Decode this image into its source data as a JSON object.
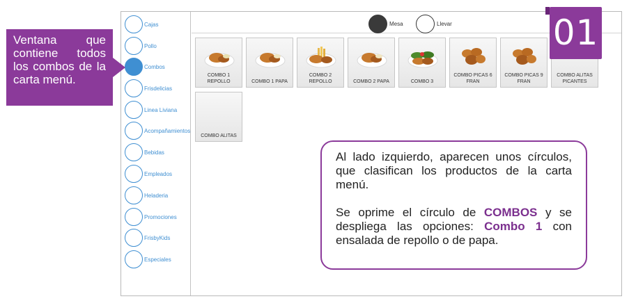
{
  "categories": [
    {
      "label": "Cajas"
    },
    {
      "label": "Pollo"
    },
    {
      "label": "Combos",
      "active": true
    },
    {
      "label": "Frisdelicias"
    },
    {
      "label": "Linea Liviana"
    },
    {
      "label": "Acompañamientos"
    },
    {
      "label": "Bebidas"
    },
    {
      "label": "Empleados"
    },
    {
      "label": "Heladeria"
    },
    {
      "label": "Promociones"
    },
    {
      "label": "FrisbyKids"
    },
    {
      "label": "Especiales"
    }
  ],
  "order_modes": [
    {
      "label": "Mesa",
      "selected": true
    },
    {
      "label": "Llevar",
      "selected": false
    }
  ],
  "products": [
    {
      "name": "COMBO 1 REPOLLO",
      "image_icon": "chicken-plate-icon"
    },
    {
      "name": "COMBO 1 PAPA",
      "image_icon": "chicken-plate-icon"
    },
    {
      "name": "COMBO 2 REPOLLO",
      "image_icon": "chicken-fries-icon"
    },
    {
      "name": "COMBO 2 PAPA",
      "image_icon": "chicken-plate-icon"
    },
    {
      "name": "COMBO 3",
      "image_icon": "chicken-salad-icon"
    },
    {
      "name": "COMBO PICAS 6 FRAN",
      "image_icon": "chicken-pieces-icon"
    },
    {
      "name": "COMBO PICAS 9 FRAN",
      "image_icon": "chicken-pieces-icon"
    },
    {
      "name": "COMBO ALITAS PICANTES",
      "image_icon": ""
    },
    {
      "name": "COMBO ALITAS",
      "image_icon": ""
    }
  ],
  "step_badge": "01",
  "callout_text": "Ventana que contiene todos los combos de la carta menú.",
  "note": {
    "paragraph1": "Al lado izquierdo, aparecen unos círculos, que clasifican los productos de la carta menú.",
    "p2_a": "Se oprime el círculo de ",
    "p2_kw1": "COMBOS",
    "p2_b": " y se despliega las opciones: ",
    "p2_kw2": "Combo 1",
    "p2_c": " con ensalada de repollo o de papa."
  },
  "colors": {
    "accent": "#8b3a9a",
    "category_blue": "#3f8fd2"
  }
}
